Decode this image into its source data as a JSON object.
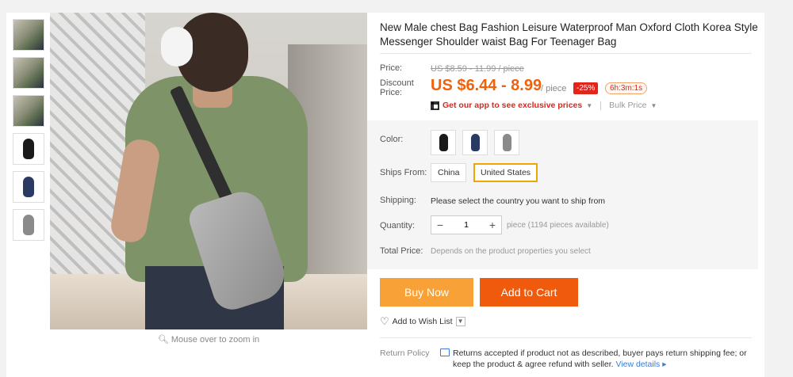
{
  "product": {
    "title": "New Male chest Bag Fashion Leisure Waterproof Man Oxford Cloth Korea Style Messenger Shoulder waist Bag For Teenager Bag"
  },
  "gallery": {
    "zoom_hint": "Mouse over to zoom in",
    "thumbnails": [
      "photo",
      "photo",
      "photo",
      "black-bag",
      "navy-bag",
      "gray-bag"
    ]
  },
  "price": {
    "label": "Price:",
    "original": "US $8.59 - 11.99 / piece",
    "discount_label": "Discount Price:",
    "discount": "US $6.44 - 8.99",
    "unit": "/ piece",
    "off_badge": "-25%",
    "timer": "6h:3m:1s",
    "app_promo": "Get our app to see exclusive prices",
    "bulk": "Bulk Price"
  },
  "options": {
    "color_label": "Color:",
    "colors": [
      "#1a1a1a",
      "#2b3a63",
      "#8a8a8a"
    ],
    "ships_from_label": "Ships From:",
    "ships_from": [
      "China",
      "United States"
    ],
    "ships_from_selected": "United States",
    "shipping_label": "Shipping:",
    "shipping_note": "Please select the country you want to ship from",
    "quantity_label": "Quantity:",
    "quantity": "1",
    "quantity_avail": "piece (1194 pieces available)",
    "total_label": "Total Price:",
    "total_note": "Depends on the product properties you select"
  },
  "actions": {
    "buy_now": "Buy Now",
    "add_to_cart": "Add to Cart",
    "wish": "Add to Wish List"
  },
  "return_policy": {
    "label": "Return Policy",
    "text": "Returns accepted if product not as described, buyer pays return shipping fee; or keep the product & agree refund with seller.",
    "view_details": "View details ▸"
  },
  "colors": {
    "accent": "#f3600a",
    "buy_now_bg": "#f8a136",
    "cart_bg": "#ef5a0c",
    "badge_red": "#e1251b"
  }
}
